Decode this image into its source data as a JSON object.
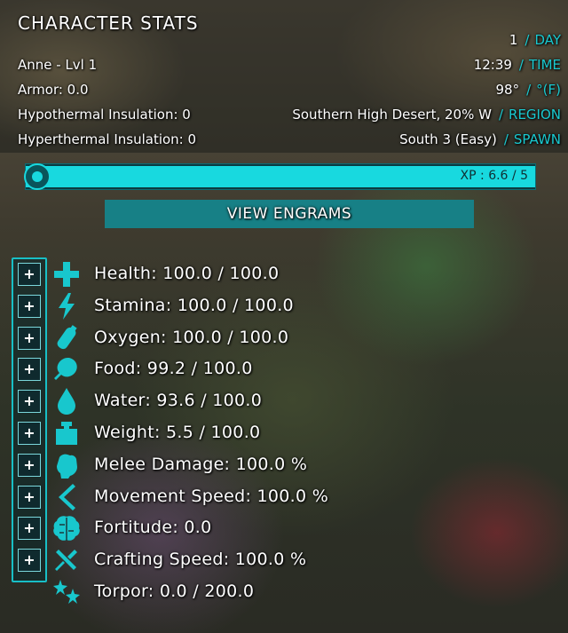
{
  "header": {
    "title": "CHARACTER STATS",
    "left_lines": [
      "Anne - Lvl 1",
      "Armor: 0.0",
      "Hypothermal Insulation: 0",
      "Hyperthermal Insulation: 0"
    ],
    "right_lines": [
      {
        "value": "1",
        "label": "DAY"
      },
      {
        "value": "12:39",
        "label": "TIME"
      },
      {
        "value": "98°",
        "label": "°(F)"
      },
      {
        "value": "Southern High Desert, 20% W",
        "label": "REGION"
      },
      {
        "value": "South 3 (Easy)",
        "label": "SPAWN"
      }
    ],
    "separator": "/"
  },
  "xp": {
    "label": "XP : 6.6 / 5",
    "progress": 1.0
  },
  "engrams_button": {
    "label": "VIEW ENGRAMS"
  },
  "plus_label": "+",
  "stats": [
    {
      "text": "Health: 100.0 / 100.0",
      "icon": "health-cross-icon",
      "upgradable": true
    },
    {
      "text": "Stamina: 100.0 / 100.0",
      "icon": "stamina-bolt-icon",
      "upgradable": true
    },
    {
      "text": "Oxygen: 100.0 / 100.0",
      "icon": "oxygen-tank-icon",
      "upgradable": true
    },
    {
      "text": "Food: 99.2 / 100.0",
      "icon": "food-meat-icon",
      "upgradable": true
    },
    {
      "text": "Water: 93.6 / 100.0",
      "icon": "water-drop-icon",
      "upgradable": true
    },
    {
      "text": "Weight: 5.5 / 100.0",
      "icon": "weight-icon",
      "upgradable": true
    },
    {
      "text": "Melee Damage: 100.0 %",
      "icon": "melee-fist-icon",
      "upgradable": true
    },
    {
      "text": "Movement Speed: 100.0 %",
      "icon": "movement-icon",
      "upgradable": true
    },
    {
      "text": "Fortitude: 0.0",
      "icon": "fortitude-brain-icon",
      "upgradable": true
    },
    {
      "text": "Crafting Speed: 100.0 %",
      "icon": "crafting-tools-icon",
      "upgradable": true
    },
    {
      "text": "Torpor: 0.0 / 200.0",
      "icon": "torpor-stars-icon",
      "upgradable": false
    }
  ],
  "colors": {
    "accent": "#18d9df",
    "accent_dark": "#178086",
    "text": "#ffffff"
  }
}
